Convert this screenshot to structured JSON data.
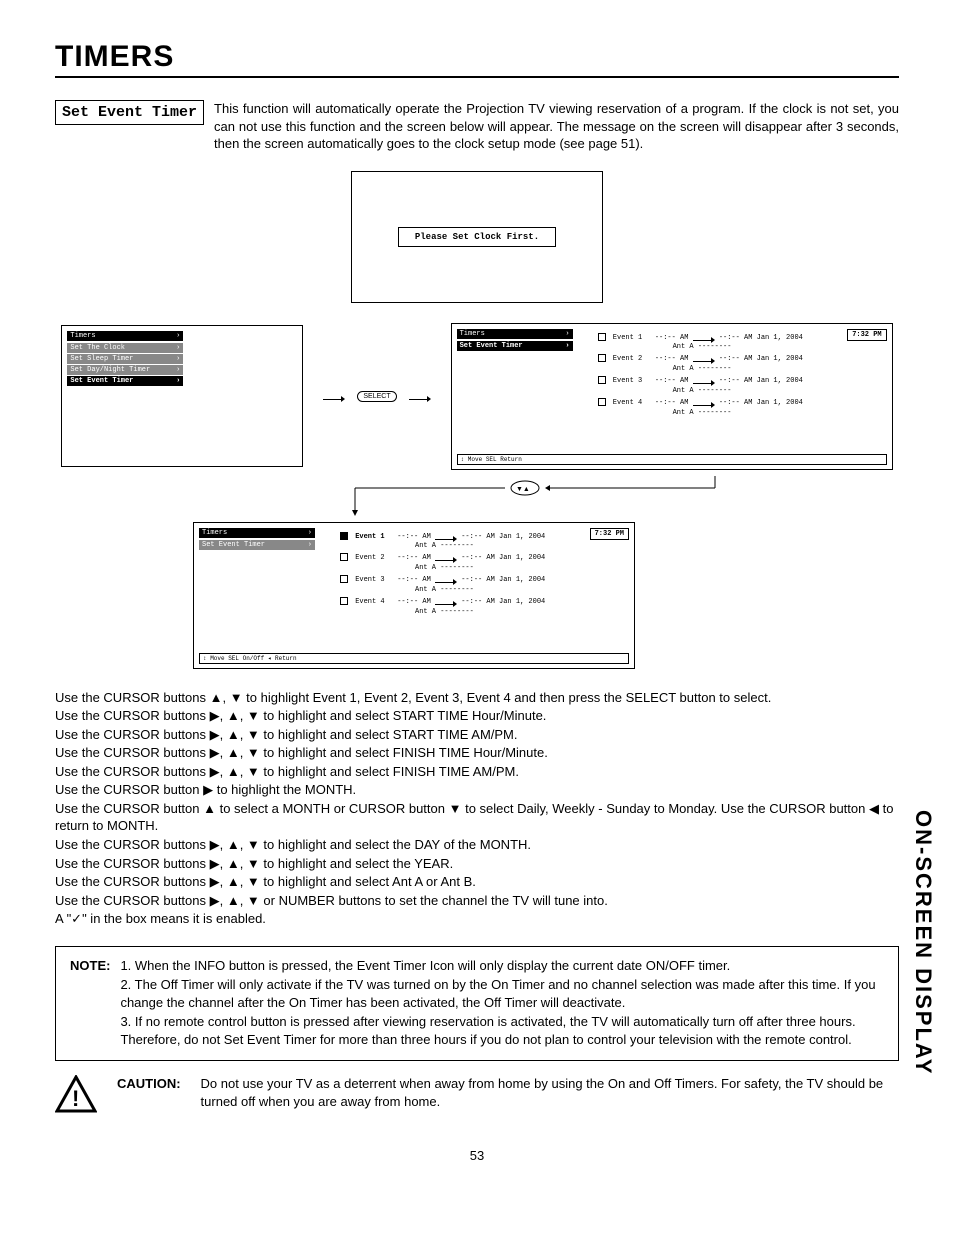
{
  "page": {
    "title": "TIMERS",
    "number": "53",
    "side_label": "ON-SCREEN DISPLAY"
  },
  "label": "Set Event Timer",
  "intro": "This function will automatically operate the Projection TV viewing reservation of a program.  If the clock is not set, you can not use this function and the screen below will appear.  The message on the screen will disappear after 3 seconds, then the screen automatically goes to the clock setup mode (see page 51).",
  "clock_msg": "Please Set Clock First.",
  "screen_a": {
    "header": "Timers",
    "items": [
      "Set The Clock",
      "Set Sleep Timer",
      "Set Day/Night Timer",
      "Set Event Timer"
    ]
  },
  "select_btn": "SELECT",
  "screen_b": {
    "header": "Timers",
    "subheader": "Set Event Timer",
    "time": "7:32 PM",
    "events": [
      {
        "n": "Event 1",
        "t": "--:-- AM",
        "t2": "--:-- AM  Jan 1, 2004",
        "ant": "Ant A --------"
      },
      {
        "n": "Event 2",
        "t": "--:-- AM",
        "t2": "--:-- AM  Jan 1, 2004",
        "ant": "Ant A --------"
      },
      {
        "n": "Event 3",
        "t": "--:-- AM",
        "t2": "--:-- AM  Jan 1, 2004",
        "ant": "Ant A --------"
      },
      {
        "n": "Event 4",
        "t": "--:-- AM",
        "t2": "--:-- AM  Jan 1, 2004",
        "ant": "Ant A --------"
      }
    ],
    "footer": "↕ Move  SEL  Return"
  },
  "screen_c": {
    "header": "Timers",
    "subheader": "Set Event Timer",
    "time": "7:32 PM",
    "events": [
      {
        "n": "Event 1",
        "sel": true,
        "t": "--:-- AM",
        "t2": "--:-- AM  Jan 1, 2004",
        "ant": "Ant A --------"
      },
      {
        "n": "Event 2",
        "sel": false,
        "t": "--:-- AM",
        "t2": "--:-- AM  Jan 1, 2004",
        "ant": "Ant A --------"
      },
      {
        "n": "Event 3",
        "sel": false,
        "t": "--:-- AM",
        "t2": "--:-- AM  Jan 1, 2004",
        "ant": "Ant A --------"
      },
      {
        "n": "Event 4",
        "sel": false,
        "t": "--:-- AM",
        "t2": "--:-- AM  Jan 1, 2004",
        "ant": "Ant A --------"
      }
    ],
    "footer": "↕ Move  SEL On/Off  ◂ Return"
  },
  "instructions": [
    "Use the CURSOR buttons ▲, ▼ to highlight Event 1, Event 2, Event 3, Event 4 and then press the SELECT button to select.",
    "Use the CURSOR buttons ▶, ▲, ▼ to highlight and select START TIME Hour/Minute.",
    "Use the CURSOR buttons ▶, ▲, ▼ to highlight and select START TIME AM/PM.",
    "Use the CURSOR buttons ▶, ▲, ▼ to highlight and select FINISH TIME Hour/Minute.",
    "Use the CURSOR buttons ▶, ▲, ▼ to highlight and select FINISH TIME AM/PM.",
    "Use the CURSOR button ▶ to highlight the MONTH.",
    "Use the CURSOR button ▲ to select a MONTH or CURSOR button ▼ to select Daily, Weekly - Sunday to Monday.  Use the CURSOR button ◀ to return to MONTH.",
    "Use the CURSOR buttons ▶, ▲, ▼ to highlight and select the DAY of the MONTH.",
    "Use the CURSOR buttons ▶, ▲, ▼ to highlight and select the YEAR.",
    "Use the CURSOR buttons ▶, ▲, ▼ to highlight and select Ant A or Ant B.",
    "Use the CURSOR buttons ▶, ▲, ▼ or NUMBER buttons to set the channel the TV will tune into.",
    "A \"✓\" in the box means it is enabled."
  ],
  "note": {
    "label": "NOTE:",
    "items": [
      "1. When the INFO button is pressed, the Event Timer Icon will only display the current date ON/OFF timer.",
      "2. The Off Timer will only activate if the TV was turned on by the On Timer and no channel selection was made after this time.  If you change the channel after the On Timer has been activated, the Off Timer will deactivate.",
      "3. If no remote control button is pressed after viewing reservation is activated, the TV will automatically turn off after three hours.  Therefore, do not Set Event Timer for more than three hours if you do not plan to control your television with the remote control."
    ]
  },
  "caution": {
    "label": "CAUTION:",
    "text": "Do not use your TV as a deterrent when away from home by using the On and Off Timers.  For safety, the TV should be turned off when you are away from home."
  }
}
